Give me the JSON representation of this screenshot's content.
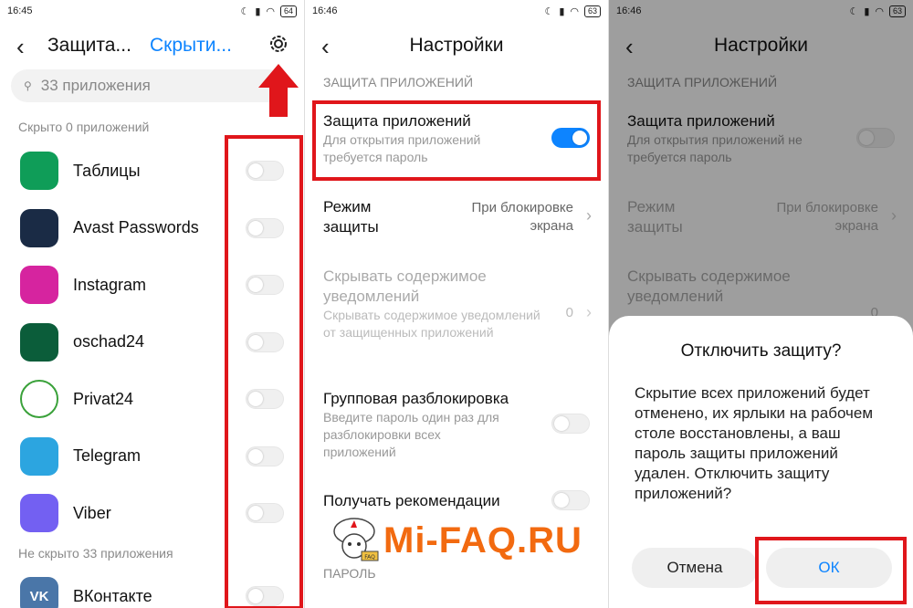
{
  "panel1": {
    "time": "16:45",
    "battery": "64",
    "header_left": "Защита...",
    "header_right": "Скрыти...",
    "search_placeholder": "33 приложения",
    "hidden_header": "Скрыто 0 приложений",
    "apps": [
      {
        "name": "Таблицы",
        "icon": "sheets-icon",
        "color": "#0f9d58"
      },
      {
        "name": "Avast Passwords",
        "icon": "key-icon",
        "color": "#1a2b45"
      },
      {
        "name": "Instagram",
        "icon": "instagram-icon",
        "color": "#d6249f"
      },
      {
        "name": "oschad24",
        "icon": "oschad-icon",
        "color": "#0b5d3a"
      },
      {
        "name": "Privat24",
        "icon": "privat-icon",
        "color": "#ffffff"
      },
      {
        "name": "Telegram",
        "icon": "telegram-icon",
        "color": "#2ca5e0"
      },
      {
        "name": "Viber",
        "icon": "viber-icon",
        "color": "#7360f2"
      }
    ],
    "not_hidden_header": "Не скрыто 33 приложения",
    "last_app": {
      "name": "ВКонтакте",
      "icon": "vk-icon",
      "color": "#4a76a8"
    }
  },
  "panel2": {
    "time": "16:46",
    "battery": "63",
    "title": "Настройки",
    "section_protection": "ЗАЩИТА ПРИЛОЖЕНИЙ",
    "app_protection_title": "Защита приложений",
    "app_protection_sub": "Для открытия приложений требуется пароль",
    "mode_title": "Режим защиты",
    "mode_value": "При блокировке экрана",
    "hide_title": "Скрывать содержимое уведомлений",
    "hide_sub": "Скрывать содержимое уведомлений от защищенных приложений",
    "hide_count": "0",
    "group_title": "Групповая разблокировка",
    "group_sub": "Введите пароль один раз для разблокировки всех приложений",
    "recommend_title": "Получать рекомендации",
    "section_password": "ПАРОЛЬ"
  },
  "panel3": {
    "time": "16:46",
    "battery": "63",
    "title": "Настройки",
    "section_protection": "ЗАЩИТА ПРИЛОЖЕНИЙ",
    "app_protection_title": "Защита приложений",
    "app_protection_sub": "Для открытия приложений не требуется пароль",
    "mode_title": "Режим защиты",
    "mode_value": "При блокировке экрана",
    "hide_title": "Скрывать содержимое уведомлений",
    "hide_count": "0",
    "dialog_title": "Отключить защиту?",
    "dialog_body": "Скрытие всех приложений будет отменено, их ярлыки на рабочем столе восстановлены, а ваш пароль защиты приложений удален. Отключить защиту приложений?",
    "cancel_label": "Отмена",
    "ok_label": "ОК"
  },
  "watermark": "Mi-FAQ.RU",
  "watermark_badge": "FAQ",
  "colors": {
    "accent": "#0d84ff",
    "highlight": "#e0161b",
    "watermark": "#f26a10"
  }
}
